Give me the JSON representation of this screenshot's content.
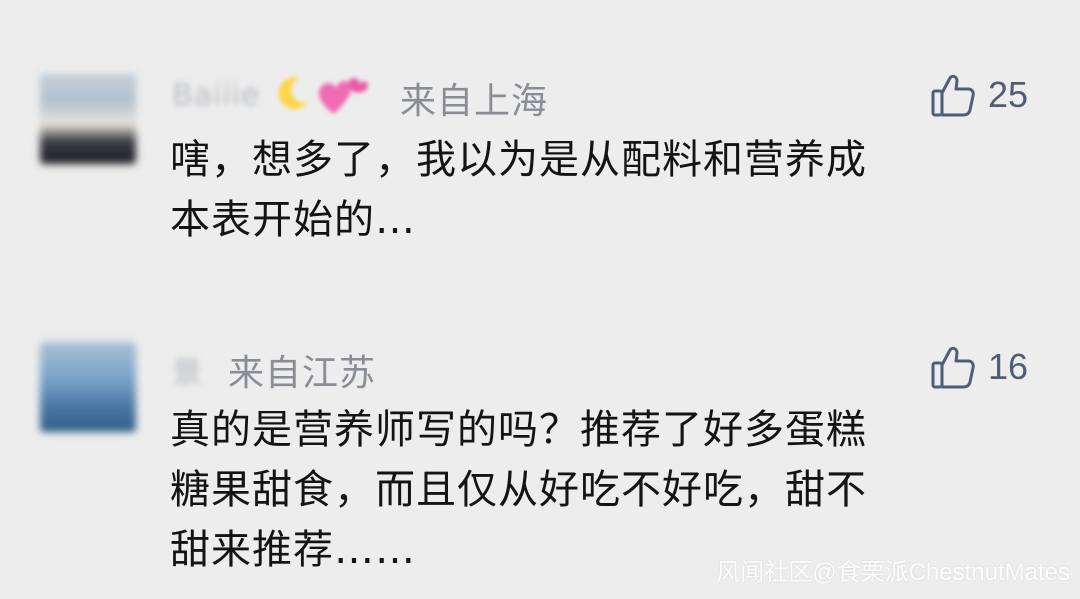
{
  "comments": [
    {
      "author": "Baiiie",
      "location": "来自上海",
      "likes": "25",
      "text": "嗐，想多了，我以为是从配料和营养成\n本表开始的…"
    },
    {
      "author": "景",
      "location": "来自江苏",
      "likes": "16",
      "text": "真的是营养师写的吗？推荐了好多蛋糕\n糖果甜食，而且仅从好吃不好吃，甜不\n甜来推荐……"
    }
  ],
  "watermark": "风闻社区@食栗派ChestnutMates",
  "icons": {
    "like": "thumbs-up-icon",
    "moon": "crescent-moon-emoji",
    "heart": "pink-heart-emoji"
  },
  "colors": {
    "background": "#ededed",
    "like_color": "#4f5d77",
    "location_color": "#8a8d93",
    "text_color": "#141414"
  }
}
